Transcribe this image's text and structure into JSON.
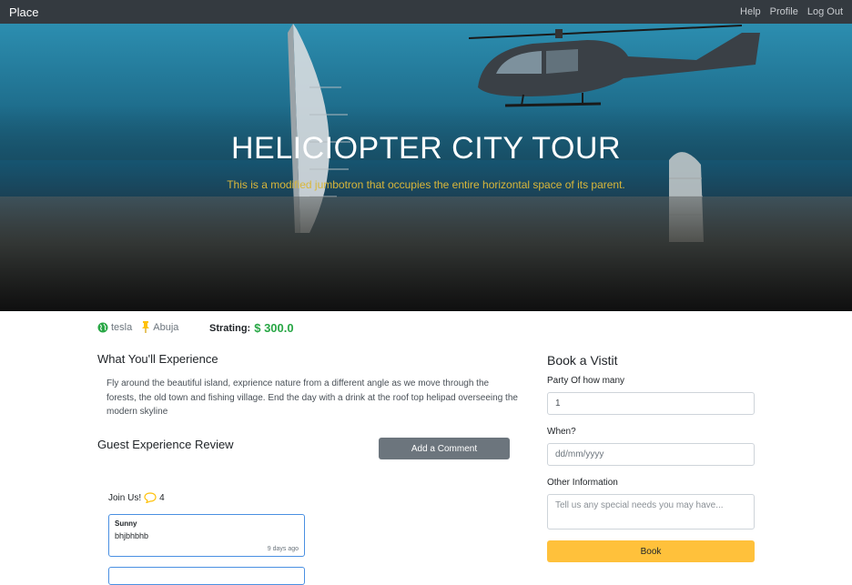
{
  "navbar": {
    "brand": "Place",
    "links": [
      "Help",
      "Profile",
      "Log Out"
    ]
  },
  "hero": {
    "title": "HELICIOPTER CITY TOUR",
    "subtitle": "This is a modified jumbotron that occupies the entire horizontal space of its parent."
  },
  "meta": {
    "host": "tesla",
    "location": "Abuja",
    "strating_label": "Strating:",
    "strating_value": "$ 300.0"
  },
  "experience": {
    "heading": "What You'll Experience",
    "text": "Fly around the beautiful island, exprience nature from a different angle as we move through the forests, the old town and fishing village. End the day with a drink at the roof top helipad overseeing the modern skyline"
  },
  "reviews": {
    "heading": "Guest Experience Review",
    "add_button": "Add a Comment",
    "join_label": "Join Us!",
    "comment_count": "4",
    "comments": [
      {
        "author": "Sunny",
        "text": "bhjbhbhb",
        "time": "9 days ago"
      }
    ]
  },
  "booking": {
    "heading": "Book a Vistit",
    "party_label": "Party Of how many",
    "party_value": "1",
    "when_label": "When?",
    "when_placeholder": "dd/mm/yyyy",
    "info_label": "Other Information",
    "info_placeholder": "Tell us any special needs you may have...",
    "book_button": "Book"
  },
  "colors": {
    "navbar": "#343a40",
    "price": "#28a745",
    "book_button": "#ffc13b",
    "comment_button": "#6c757d",
    "subtitle": "#d9b73a"
  }
}
